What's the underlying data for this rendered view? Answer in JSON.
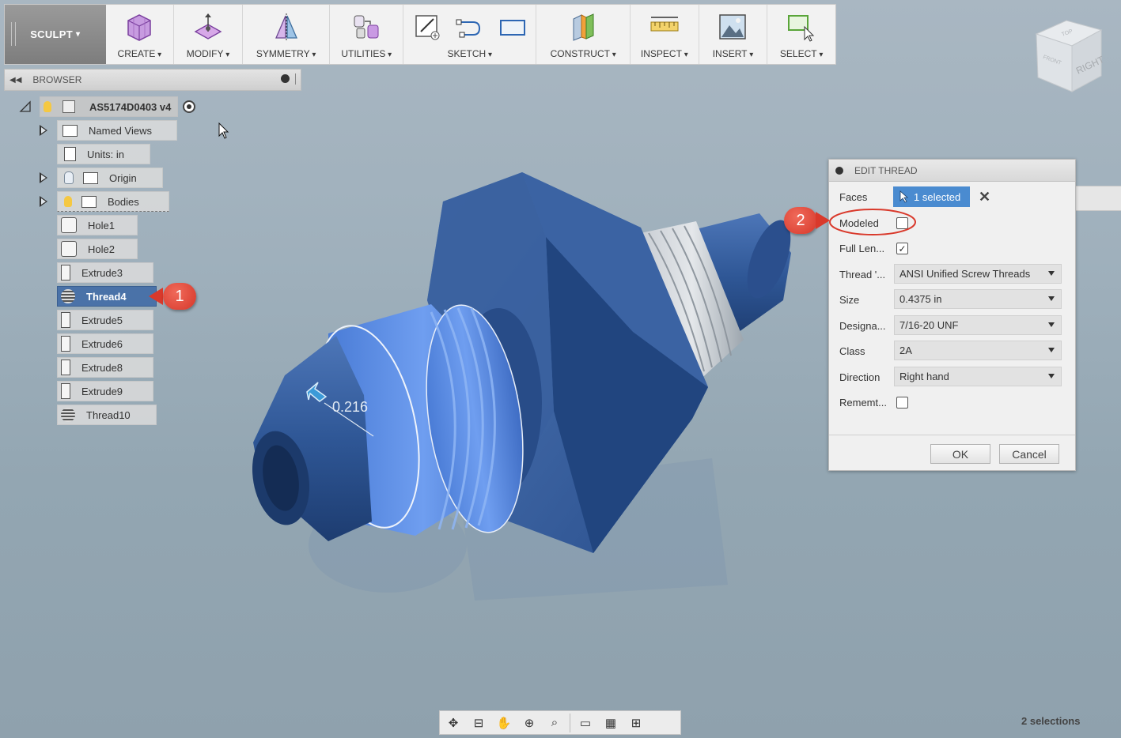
{
  "toolbar": {
    "workspace": "SCULPT",
    "groups": [
      {
        "label": "CREATE",
        "icon": "create-box-icon"
      },
      {
        "label": "MODIFY",
        "icon": "modify-icon"
      },
      {
        "label": "SYMMETRY",
        "icon": "symmetry-icon"
      },
      {
        "label": "UTILITIES",
        "icon": "utilities-icon"
      },
      {
        "label": "SKETCH",
        "icon": "sketch-icon"
      },
      {
        "label": "CONSTRUCT",
        "icon": "construct-icon"
      },
      {
        "label": "INSPECT",
        "icon": "ruler-icon"
      },
      {
        "label": "INSERT",
        "icon": "image-icon"
      },
      {
        "label": "SELECT",
        "icon": "select-icon"
      }
    ]
  },
  "browser": {
    "title": "BROWSER",
    "root": "AS5174D0403 v4",
    "items": [
      {
        "label": "Named Views"
      },
      {
        "label": "Units: in"
      },
      {
        "label": "Origin"
      },
      {
        "label": "Bodies"
      },
      {
        "label": "Hole1"
      },
      {
        "label": "Hole2"
      },
      {
        "label": "Extrude3"
      },
      {
        "label": "Thread4"
      },
      {
        "label": "Extrude5"
      },
      {
        "label": "Extrude6"
      },
      {
        "label": "Extrude8"
      },
      {
        "label": "Extrude9"
      },
      {
        "label": "Thread10"
      }
    ]
  },
  "callouts": {
    "one": "1",
    "two": "2"
  },
  "viewcube": {
    "face_right": "RIGHT",
    "face_front": "FRONT",
    "face_top": "TOP"
  },
  "model": {
    "dimension": "0.216"
  },
  "dialog": {
    "title": "EDIT THREAD",
    "faces_label": "Faces",
    "faces_value": "1 selected",
    "modeled_label": "Modeled",
    "full_length_label": "Full Len...",
    "thread_type_label": "Thread '...",
    "thread_type_value": "ANSI Unified Screw Threads",
    "size_label": "Size",
    "size_value": "0.4375 in",
    "designation_label": "Designa...",
    "designation_value": "7/16-20 UNF",
    "class_label": "Class",
    "class_value": "2A",
    "direction_label": "Direction",
    "direction_value": "Right hand",
    "remember_label": "Rememt...",
    "ok": "OK",
    "cancel": "Cancel"
  },
  "status": "2 selections"
}
